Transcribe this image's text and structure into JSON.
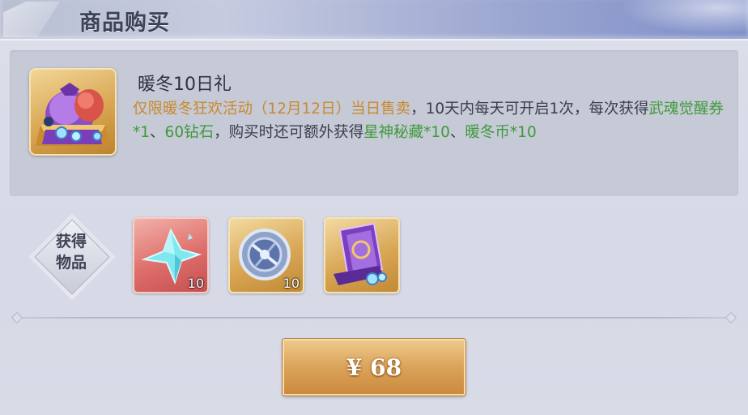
{
  "header": {
    "title": "商品购买"
  },
  "package": {
    "title": "暖冬10日礼",
    "desc_parts": [
      {
        "text": "仅限暖冬狂欢活动（12月12日）当日售卖",
        "style": "orange"
      },
      {
        "text": "，10天内每天可开启1次，每次获得",
        "style": "normal"
      },
      {
        "text": "武魂觉醒券*1",
        "style": "green"
      },
      {
        "text": "、",
        "style": "normal"
      },
      {
        "text": "60钻石",
        "style": "green"
      },
      {
        "text": "，购买时还可额外获得",
        "style": "normal"
      },
      {
        "text": "星神秘藏*10",
        "style": "green"
      },
      {
        "text": "、",
        "style": "normal"
      },
      {
        "text": "暖冬币*10",
        "style": "green"
      }
    ]
  },
  "rewards": {
    "label": "获得物品",
    "items": [
      {
        "icon": "crystal-icon",
        "count": "10",
        "frame": "red"
      },
      {
        "icon": "awakening-ticket-icon",
        "count": "10",
        "frame": "gold"
      },
      {
        "icon": "treasure-scroll-icon",
        "count": "",
        "frame": "gold"
      }
    ]
  },
  "purchase": {
    "price_label": "¥ 68"
  },
  "colors": {
    "highlight_orange": "#c98a2c",
    "highlight_green": "#3f9a3a",
    "button_gold": "#dba35a"
  }
}
